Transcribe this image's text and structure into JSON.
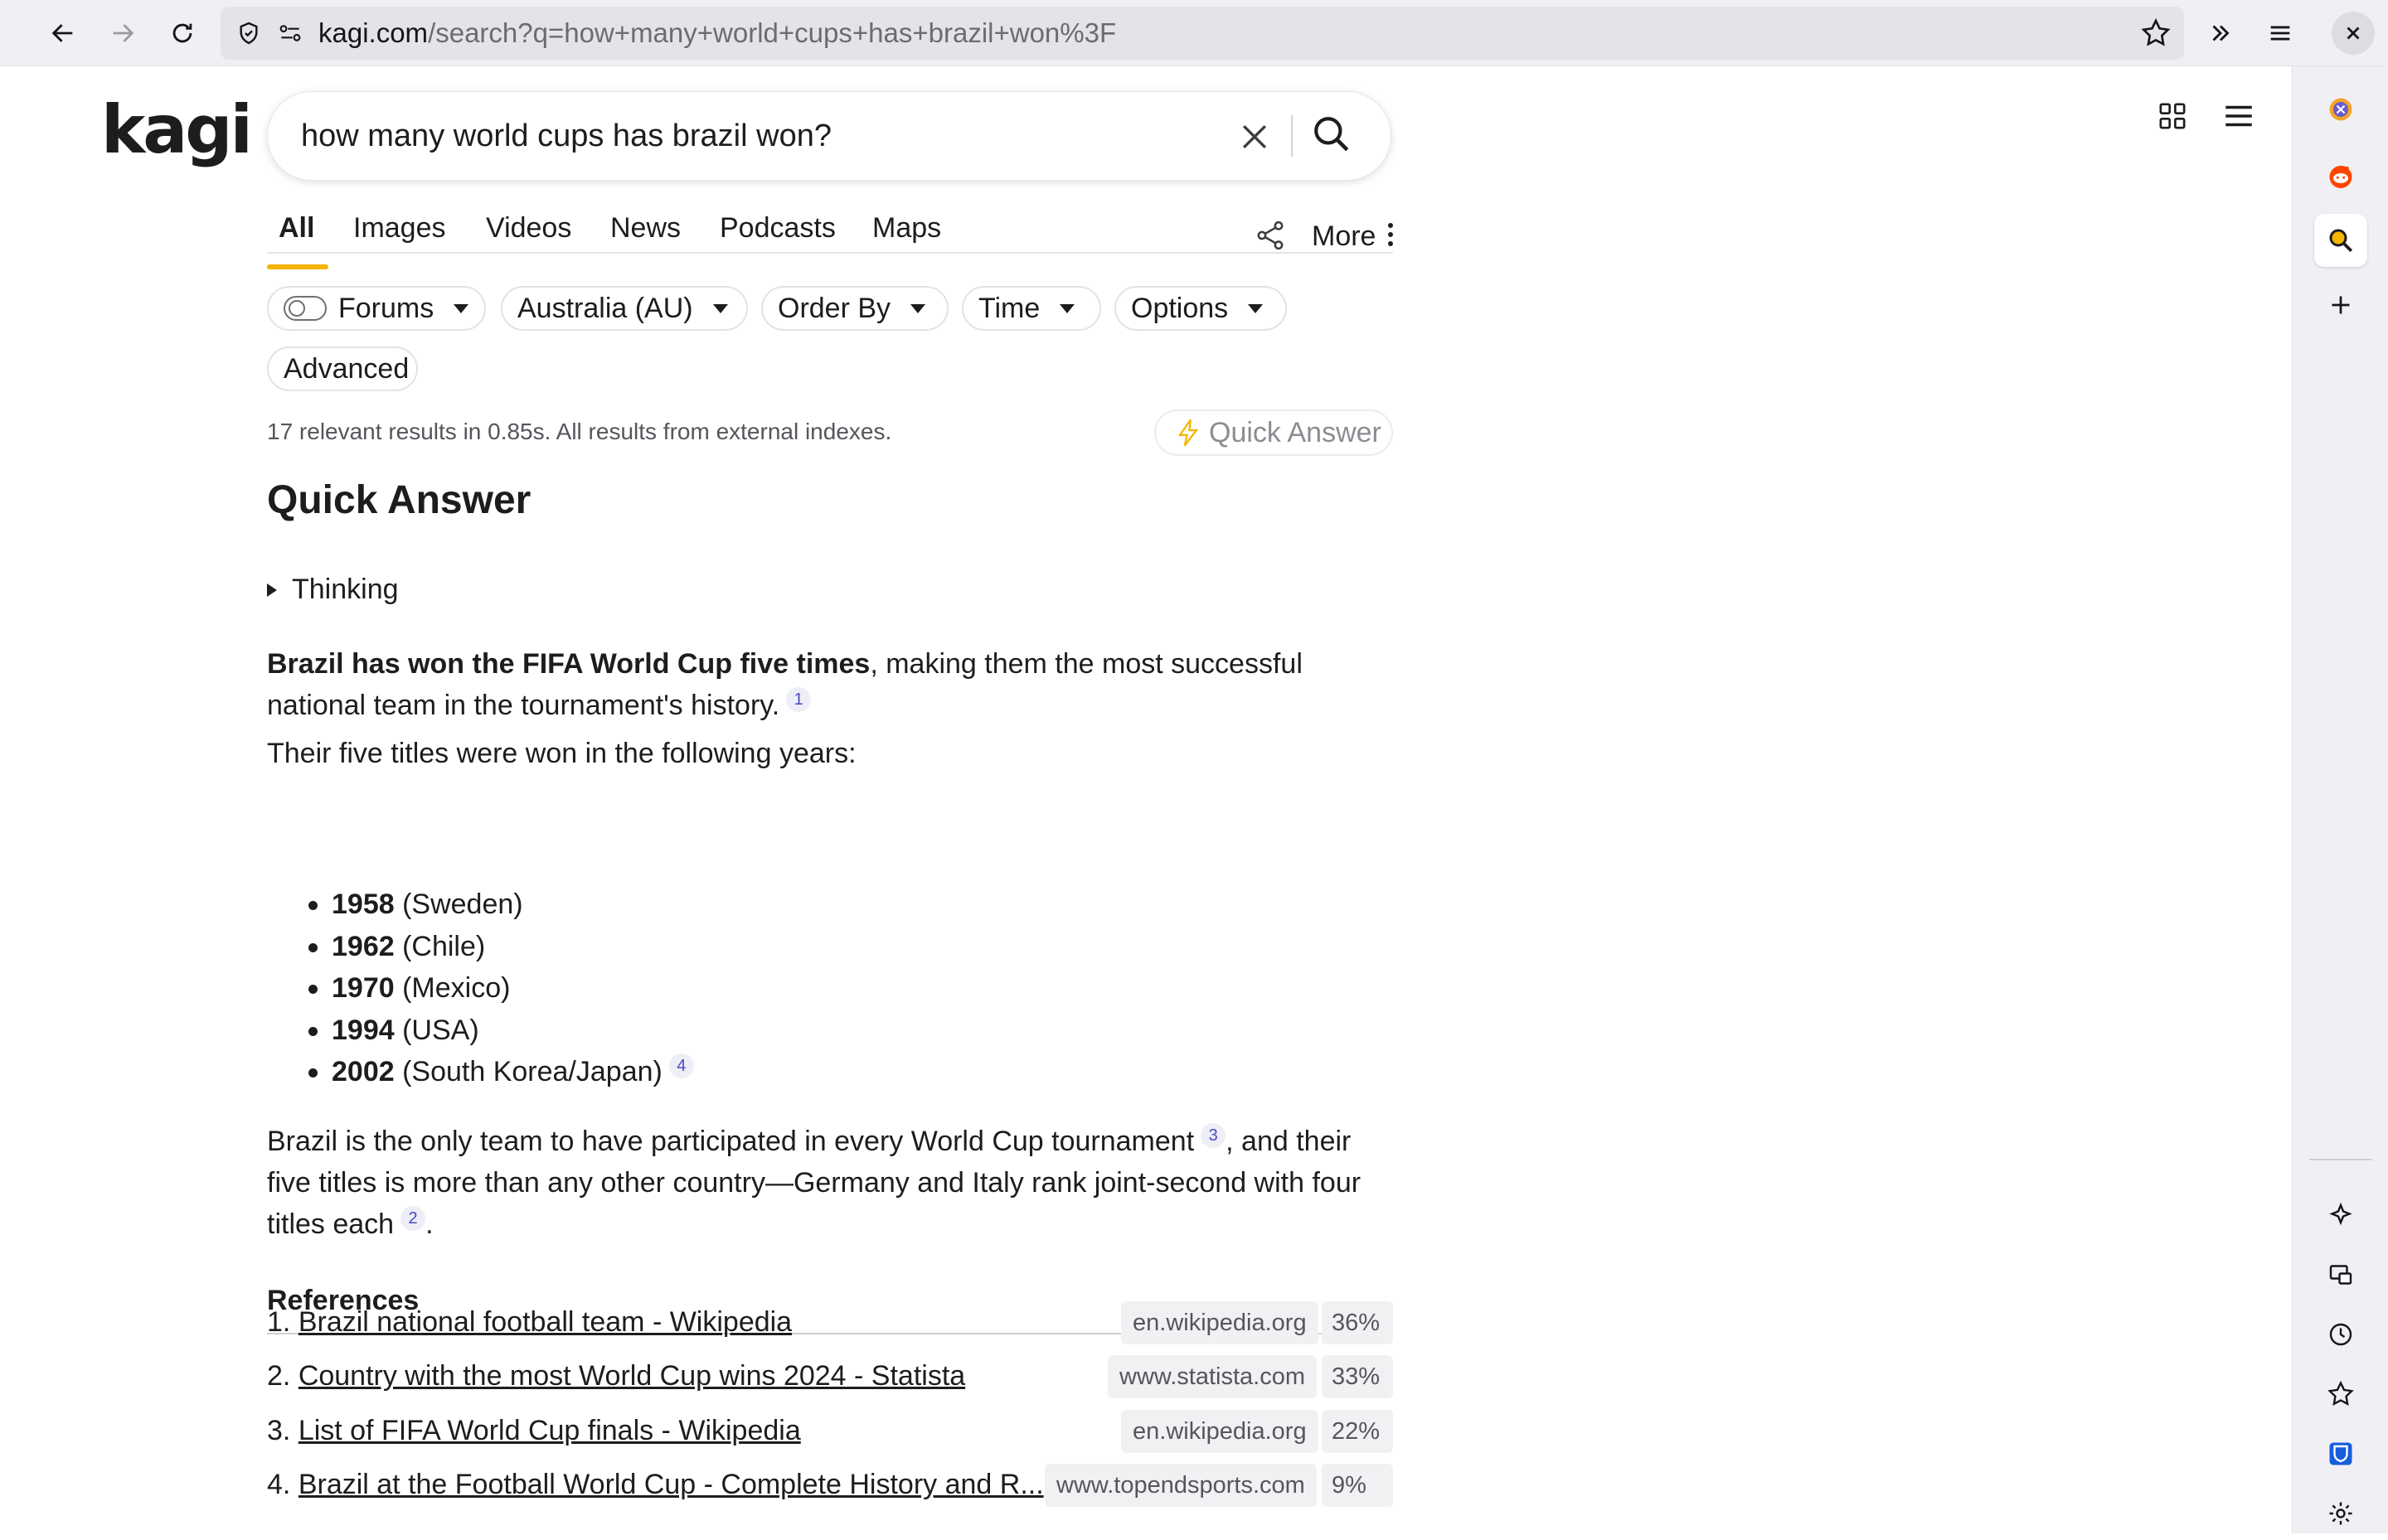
{
  "browser": {
    "url_host": "kagi.com",
    "url_rest": "/search?q=how+many+world+cups+has+brazil+won%3F"
  },
  "brand": {
    "logo_text": "kagi",
    "accent_color": "#f4b400"
  },
  "search": {
    "query": "how many world cups has brazil won?"
  },
  "tabs": [
    {
      "label": "All",
      "active": true
    },
    {
      "label": "Images"
    },
    {
      "label": "Videos"
    },
    {
      "label": "News"
    },
    {
      "label": "Podcasts"
    },
    {
      "label": "Maps"
    }
  ],
  "more_label": "More",
  "filters": {
    "forums": "Forums",
    "region": "Australia (AU)",
    "order_by": "Order By",
    "time": "Time",
    "options": "Options",
    "advanced": "Advanced"
  },
  "stats": "17 relevant results in 0.85s. All results from external indexes.",
  "quick_answer_button": "Quick Answer",
  "quick_answer": {
    "title": "Quick Answer",
    "thinking_label": "Thinking",
    "p1_bold": "Brazil has won the FIFA World Cup five times",
    "p1_rest": ", making them the most successful national team in the tournament's history.",
    "p1_cite": "1",
    "p2": "Their five titles were won in the following years:",
    "years": [
      {
        "year": "1958",
        "place": " (Sweden)"
      },
      {
        "year": "1962",
        "place": " (Chile)"
      },
      {
        "year": "1970",
        "place": " (Mexico)"
      },
      {
        "year": "1994",
        "place": " (USA)"
      },
      {
        "year": "2002",
        "place": " (South Korea/Japan)",
        "cite": "4"
      }
    ],
    "p3_a": "Brazil is the only team to have participated in every World Cup tournament",
    "p3_cite_a": "3",
    "p3_b": ", and their five titles is more than any other country—Germany and Italy rank joint-second with four titles each",
    "p3_cite_b": "2",
    "p3_c": "."
  },
  "references": {
    "title": "References",
    "items": [
      {
        "num": "1.",
        "title": "Brazil national football team - Wikipedia",
        "domain": "en.wikipedia.org",
        "pct": "36%"
      },
      {
        "num": "2.",
        "title": "Country with the most World Cup wins 2024 - Statista",
        "domain": "www.statista.com",
        "pct": "33%"
      },
      {
        "num": "3.",
        "title": "List of FIFA World Cup finals - Wikipedia",
        "domain": "en.wikipedia.org",
        "pct": "22%"
      },
      {
        "num": "4.",
        "title": "Brazil at the Football World Cup - Complete History and R...",
        "domain": "www.topendsports.com",
        "pct": "9%"
      }
    ]
  }
}
